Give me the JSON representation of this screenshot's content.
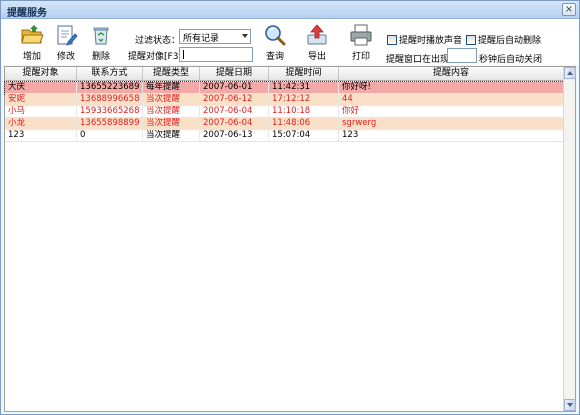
{
  "window": {
    "title": "提醒服务",
    "close_glyph": "×"
  },
  "toolbar": {
    "add_label": "增加",
    "edit_label": "修改",
    "delete_label": "删除",
    "query_label": "查询",
    "export_label": "导出",
    "print_label": "打印"
  },
  "filter": {
    "status_label": "过滤状态：",
    "status_value": "所有记录",
    "object_label": "提醒对像[F3]",
    "object_value": ""
  },
  "options": {
    "play_sound_label": "提醒时播放声音",
    "delete_after_label": "提醒后自动删除",
    "interval_label": "提醒窗口在出现",
    "interval_value": "",
    "interval_suffix": "秒钟后自动关闭"
  },
  "table": {
    "columns": [
      "提醒对象",
      "联系方式",
      "提醒类型",
      "提醒日期",
      "提醒时间",
      "提醒内容"
    ],
    "rows": [
      {
        "cells": [
          "大庆",
          "13655223689",
          "每年提醒",
          "2007-06-01",
          "11:42:31",
          "你好呀!"
        ],
        "color": "#000000",
        "bg": "#f4a9a9",
        "selected": true
      },
      {
        "cells": [
          "安妮",
          "13688996658",
          "当次提醒",
          "2007-06-12",
          "17:12:12",
          "44"
        ],
        "color": "#e02020",
        "bg": "#fbe0c8",
        "selected": false
      },
      {
        "cells": [
          "小马",
          "15933665268",
          "当次提醒",
          "2007-06-04",
          "11:10:18",
          "你好"
        ],
        "color": "#e02020",
        "bg": "#ffffff",
        "selected": false
      },
      {
        "cells": [
          "小龙",
          "13655898899",
          "当次提醒",
          "2007-06-04",
          "11:48:06",
          "sgrwerg"
        ],
        "color": "#e02020",
        "bg": "#fbe0c8",
        "selected": false
      },
      {
        "cells": [
          "123",
          "0",
          "当次提醒",
          "2007-06-13",
          "15:07:04",
          "123"
        ],
        "color": "#000000",
        "bg": "#ffffff",
        "selected": false
      }
    ]
  },
  "colors": {
    "accent": "#15315a",
    "selected_row": "#f4a9a9",
    "alt_row": "#fbe0c8",
    "highlight_text": "#e02020"
  }
}
